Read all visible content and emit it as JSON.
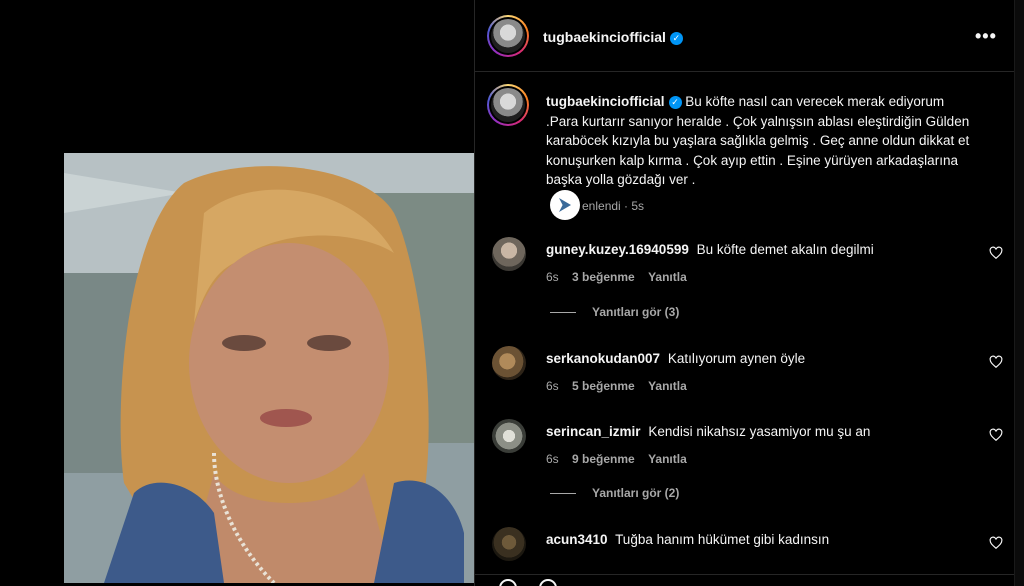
{
  "post": {
    "username": "tugbaekinciofficial",
    "verified_icon": "verified-badge-icon",
    "more_icon": "more-options-icon",
    "more_label": "•••"
  },
  "caption": {
    "username": "tugbaekinciofficial",
    "text": "Bu köfte nasıl can verecek merak ediyorum .Para kurtarır sanıyor heralde . Çok yalnışsın ablası eleştirdiğin Gülden karaböcek kızıyla bu yaşlara sağlıkla gelmiş . Geç anne oldun dikkat et konuşurken kalp kırma . Çok ayıp ettin . Eşine yürüyen arkadaşlarına başka yolla gözdağı ver .",
    "edited": "enlendi",
    "time": "5s"
  },
  "comments": [
    {
      "username": "guney.kuzey.16940599",
      "text": "Bu köfte demet akalın degilmi",
      "time": "6s",
      "likes": "3 beğenme",
      "reply": "Yanıtla"
    },
    {
      "username": "serkanokudan007",
      "text": "Katılıyorum aynen öyle",
      "time": "6s",
      "likes": "5 beğenme",
      "reply": "Yanıtla"
    },
    {
      "username": "serincan_izmir",
      "text": "Kendisi nikahsız yasamiyor mu şu an",
      "time": "6s",
      "likes": "9 beğenme",
      "reply": "Yanıtla"
    },
    {
      "username": "acun3410",
      "text": "Tuğba hanım hükümet gibi kadınsın"
    }
  ],
  "view_replies": [
    {
      "label": "Yanıtları gör (3)"
    },
    {
      "label": "Yanıtları gör (2)"
    }
  ],
  "colors": {
    "background": "#000000",
    "text_primary": "#f5f5f5",
    "text_secondary": "#a8a8a8",
    "verified": "#0095f6",
    "divider": "#262626"
  }
}
